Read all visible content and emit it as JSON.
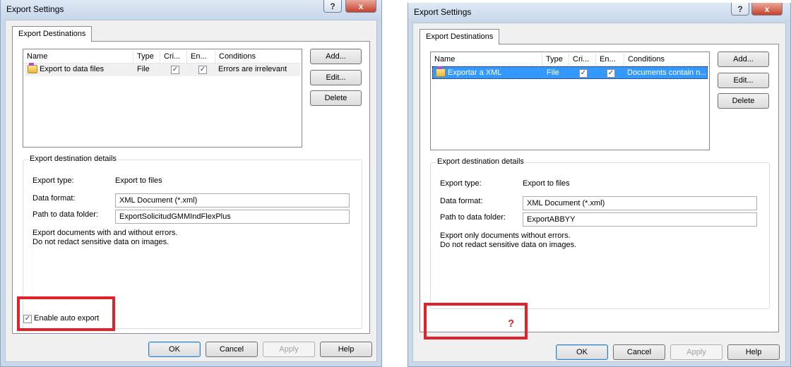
{
  "left": {
    "title": "Export Settings",
    "help_icon": "?",
    "close_icon": "x",
    "tab_label": "Export Destinations",
    "columns": [
      "Name",
      "Type",
      "Cri...",
      "En...",
      "Conditions"
    ],
    "row": {
      "name": "Export to data files",
      "type": "File",
      "critical": true,
      "enabled": true,
      "conditions": "Errors are irrelevant"
    },
    "buttons": {
      "add": "Add...",
      "edit": "Edit...",
      "delete": "Delete"
    },
    "details_title": "Export destination details",
    "export_type_label": "Export type:",
    "export_type_value": "Export to files",
    "data_format_label": "Data format:",
    "data_format_value": "XML Document (*.xml)",
    "path_label": "Path to data folder:",
    "path_value": "ExportSolicitudGMMIndFlexPlus",
    "desc_line1": "Export documents with and without errors.",
    "desc_line2": "Do not redact sensitive data on images.",
    "auto_export_label": "Enable auto export",
    "auto_export_checked": true,
    "footer": {
      "ok": "OK",
      "cancel": "Cancel",
      "apply": "Apply",
      "help": "Help"
    }
  },
  "right": {
    "title": "Export Settings",
    "help_icon": "?",
    "close_icon": "x",
    "tab_label": "Export Destinations",
    "columns": [
      "Name",
      "Type",
      "Cri...",
      "En...",
      "Conditions"
    ],
    "row": {
      "name": "Exportar a XML",
      "type": "File",
      "critical": true,
      "enabled": true,
      "conditions": "Documents contain n..."
    },
    "buttons": {
      "add": "Add...",
      "edit": "Edit...",
      "delete": "Delete"
    },
    "details_title": "Export destination details",
    "export_type_label": "Export type:",
    "export_type_value": "Export to files",
    "data_format_label": "Data format:",
    "data_format_value": "XML Document (*.xml)",
    "path_label": "Path to data folder:",
    "path_value": "ExportABBYY",
    "desc_line1": "Export only documents without errors.",
    "desc_line2": "Do not redact sensitive data on images.",
    "question_mark": "?",
    "footer": {
      "ok": "OK",
      "cancel": "Cancel",
      "apply": "Apply",
      "help": "Help"
    }
  },
  "colors": {
    "highlight_red": "#e0222a",
    "selection_blue": "#3399ff"
  }
}
